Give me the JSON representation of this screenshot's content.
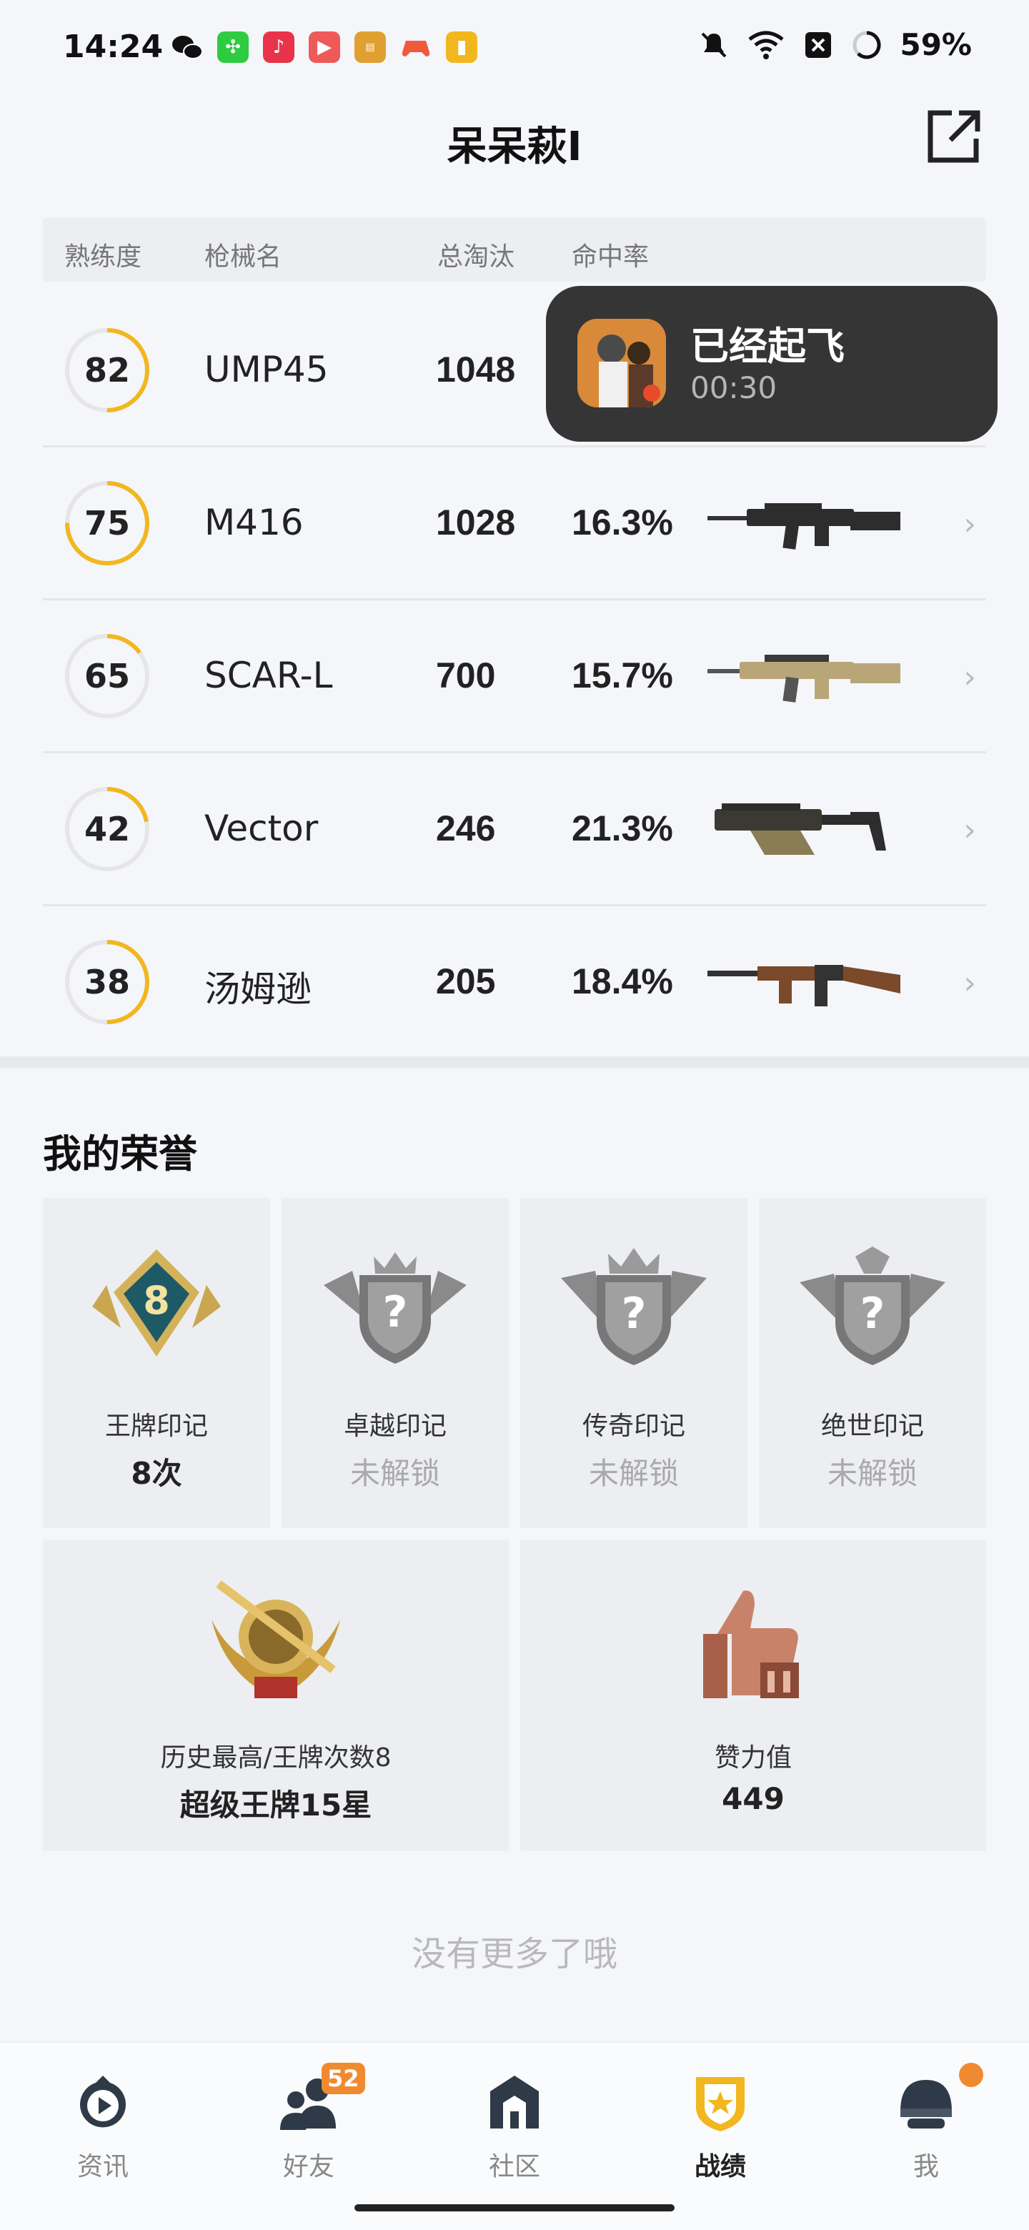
{
  "status_bar": {
    "time": "14:24",
    "battery": "59%"
  },
  "header": {
    "title": "呆呆萩I"
  },
  "table": {
    "headers": [
      "熟练度",
      "枪械名",
      "总淘汰",
      "命中率"
    ],
    "rows": [
      {
        "proficiency": "82",
        "proficiency_pct": 0.5,
        "gun": "UMP45",
        "kills": "1048",
        "rate": "",
        "gun_icon": "smg-icon"
      },
      {
        "proficiency": "75",
        "proficiency_pct": 0.75,
        "gun": "M416",
        "kills": "1028",
        "rate": "16.3%",
        "gun_icon": "rifle-icon"
      },
      {
        "proficiency": "65",
        "proficiency_pct": 0.15,
        "gun": "SCAR-L",
        "kills": "700",
        "rate": "15.7%",
        "gun_icon": "rifle-tan-icon"
      },
      {
        "proficiency": "42",
        "proficiency_pct": 0.22,
        "gun": "Vector",
        "kills": "246",
        "rate": "21.3%",
        "gun_icon": "smg-vector-icon"
      },
      {
        "proficiency": "38",
        "proficiency_pct": 0.5,
        "gun": "汤姆逊",
        "kills": "205",
        "rate": "18.4%",
        "gun_icon": "tommy-gun-icon"
      }
    ]
  },
  "toast": {
    "title": "已经起飞",
    "time": "00:30"
  },
  "honors": {
    "title": "我的荣誉",
    "cards": [
      {
        "label": "王牌印记",
        "value": "8次",
        "locked": false
      },
      {
        "label": "卓越印记",
        "value": "未解锁",
        "locked": true
      },
      {
        "label": "传奇印记",
        "value": "未解锁",
        "locked": true
      },
      {
        "label": "绝世印记",
        "value": "未解锁",
        "locked": true
      }
    ],
    "wide_cards": [
      {
        "label": "历史最高/王牌次数8",
        "value": "超级王牌15星"
      },
      {
        "label": "赞力值",
        "value": "449"
      }
    ]
  },
  "footer_text": "没有更多了哦",
  "nav": {
    "tabs": [
      {
        "label": "资讯"
      },
      {
        "label": "好友",
        "badge": "52"
      },
      {
        "label": "社区"
      },
      {
        "label": "战绩",
        "active": true
      },
      {
        "label": "我"
      }
    ]
  },
  "colors": {
    "accent": "#f2b71f",
    "badge_orange": "#f08a30"
  }
}
